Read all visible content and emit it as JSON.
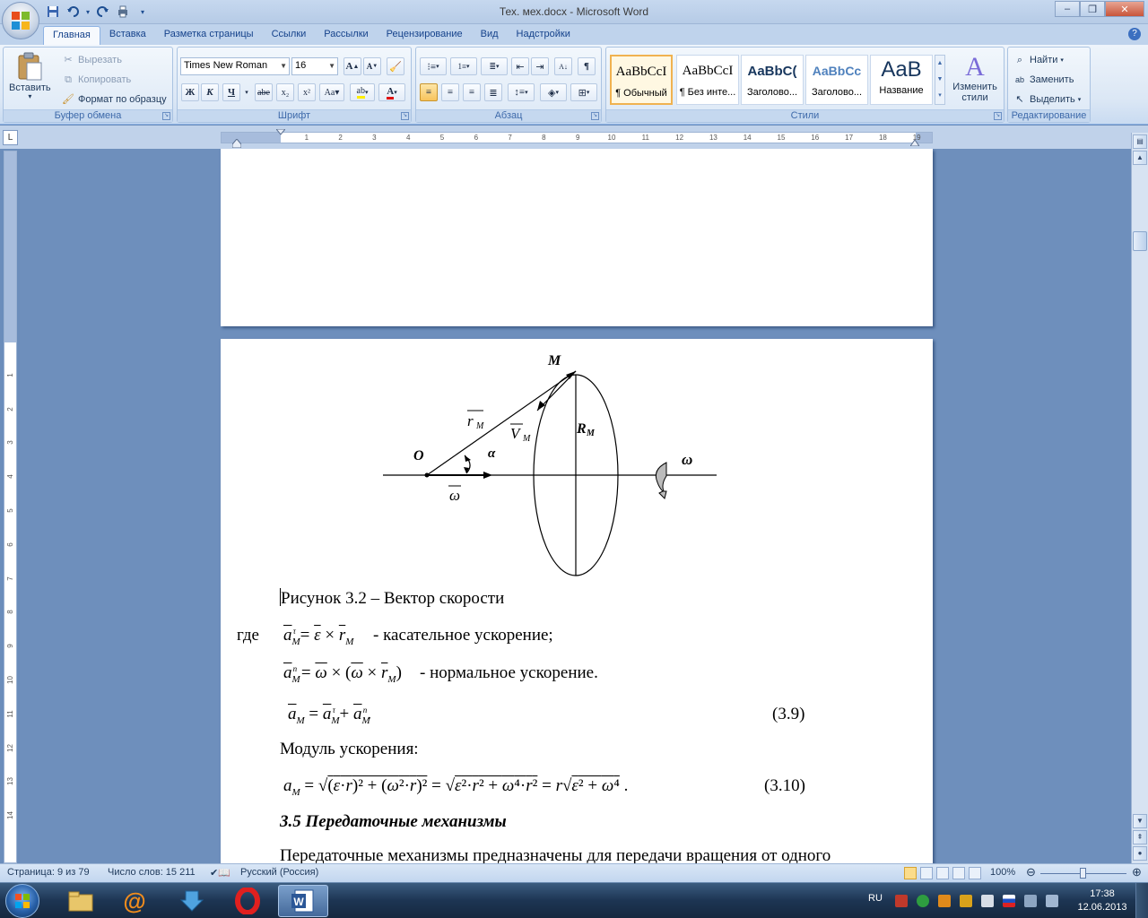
{
  "window": {
    "title": "Тех. мех.docx - Microsoft Word",
    "controls": [
      "minimize",
      "maximize",
      "close"
    ]
  },
  "quick_access": [
    "save-icon",
    "undo-icon",
    "redo-icon",
    "print-preview-icon",
    "customize-icon"
  ],
  "tabs": [
    "Главная",
    "Вставка",
    "Разметка страницы",
    "Ссылки",
    "Рассылки",
    "Рецензирование",
    "Вид",
    "Надстройки"
  ],
  "active_tab": "Главная",
  "ribbon": {
    "clipboard": {
      "label": "Буфер обмена",
      "paste": "Вставить",
      "cut": "Вырезать",
      "copy": "Копировать",
      "format_painter": "Формат по образцу"
    },
    "font": {
      "label": "Шрифт",
      "font_name": "Times New Roman",
      "font_size": "16"
    },
    "paragraph": {
      "label": "Абзац"
    },
    "styles": {
      "label": "Стили",
      "tiles": [
        {
          "sample": "AaBbCcI",
          "name": "¶ Обычный"
        },
        {
          "sample": "AaBbCcI",
          "name": "¶ Без инте..."
        },
        {
          "sample": "AaBbC(",
          "name": "Заголово..."
        },
        {
          "sample": "AaBbCc",
          "name": "Заголово..."
        },
        {
          "sample": "AaB",
          "name": "Название"
        }
      ],
      "change_styles": "Изменить стили"
    },
    "editing": {
      "label": "Редактирование",
      "find": "Найти",
      "replace": "Заменить",
      "select": "Выделить"
    }
  },
  "ruler": {
    "h_ticks": [
      "1",
      "2",
      "3",
      "4",
      "5",
      "6",
      "7",
      "8",
      "9",
      "10",
      "11",
      "12",
      "13",
      "14",
      "15",
      "16",
      "17",
      "18",
      "19"
    ],
    "v_ticks": [
      "1",
      "2",
      "3",
      "4",
      "5",
      "6",
      "7",
      "8",
      "9",
      "10",
      "11",
      "12",
      "13",
      "14"
    ]
  },
  "document": {
    "figure": {
      "label_M": "M",
      "label_O": "O",
      "label_rM": "r",
      "label_rM_sub": "M",
      "label_VM": "V",
      "label_VM_sub": "M",
      "label_RM": "R",
      "label_RM_sub": "M",
      "label_alpha": "α",
      "label_omega": "ω",
      "label_omega_vec": "ω"
    },
    "caption": "Рисунок 3.2 – Вектор скорости",
    "where": "где",
    "tangential_desc": "- касательное  ускорение;",
    "normal_desc": "- нормальное ускорение.",
    "eq_39_num": "(3.9)",
    "modulus_text": "Модуль ускорения:",
    "eq_310_num": "(3.10)",
    "section_heading": "3.5 Передаточные механизмы",
    "paragraph_start": "Передаточные  механизмы  предназначены  для  передачи  вращения  от  одного"
  },
  "status": {
    "page": "Страница: 9 из 79",
    "words": "Число слов: 15 211",
    "language": "Русский (Россия)",
    "zoom": "100%",
    "zoom_level_percent": 100
  },
  "taskbar": {
    "apps": [
      "explorer-icon",
      "mail-agent-icon",
      "downloader-icon",
      "opera-icon",
      "word-icon"
    ],
    "active_app": "word-icon",
    "lang": "RU",
    "time": "17:38",
    "date": "12.06.2013"
  },
  "colors": {
    "ribbon_blue": "#15428b",
    "doc_bg": "#6e8fbc",
    "selected_style": "#f0b250"
  }
}
